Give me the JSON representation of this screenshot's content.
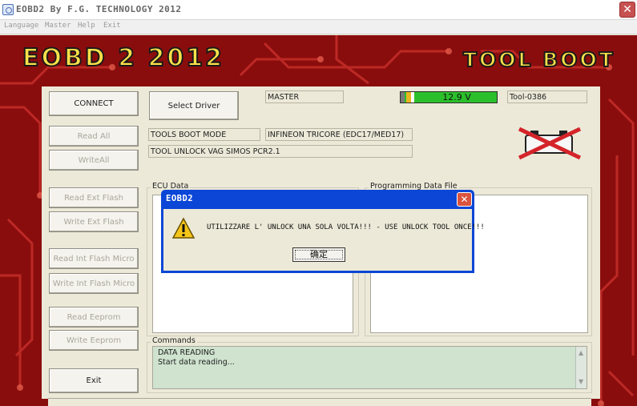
{
  "window": {
    "title": "EOBD2 By F.G. TECHNOLOGY 2012",
    "close_glyph": "✕"
  },
  "menu": [
    "Language",
    "Master",
    "Help",
    "Exit"
  ],
  "header": {
    "logo_left": "EOBD 2 2012",
    "logo_right": "TOOL BOOT"
  },
  "buttons": {
    "connect": "CONNECT",
    "select_driver": "Select Driver",
    "read_all": "Read All",
    "write_all": "WriteAll",
    "read_ext_flash": "Read Ext Flash",
    "write_ext_flash": "Write Ext Flash",
    "read_int_flash": "Read Int Flash Micro",
    "write_int_flash": "Write Int Flash Micro",
    "read_eeprom": "Read Eeprom",
    "write_eeprom": "Write Eeprom",
    "exit": "Exit"
  },
  "status": {
    "master": "MASTER",
    "voltage": "12.9 V",
    "tool_id": "Tool-0386",
    "mode": "TOOLS BOOT MODE",
    "processor": "INFINEON TRICORE (EDC17/MED17)",
    "driver": "TOOL UNLOCK VAG SIMOS PCR2.1"
  },
  "groups": {
    "ecu_data": "ECU Data",
    "programming_file": "Programming Data File",
    "commands": "Commands"
  },
  "commands_log": [
    "DATA READING",
    "Start data reading..."
  ],
  "dialog": {
    "title": "EOBD2",
    "message": "UTILIZZARE L' UNLOCK UNA SOLA VOLTA!!! - USE UNLOCK TOOL ONCE!!!",
    "ok_label": "确定",
    "close_glyph": "✕"
  },
  "icons": {
    "warning": "warning-icon",
    "standard_crossed": "standard-crossed-icon"
  },
  "colors": {
    "voltage_ok": "#2bc02b",
    "background_red": "#8a0d0d",
    "logo_yellow": "#ffe14a",
    "dialog_blue": "#0b46d6",
    "command_green": "#cfe3cf"
  }
}
